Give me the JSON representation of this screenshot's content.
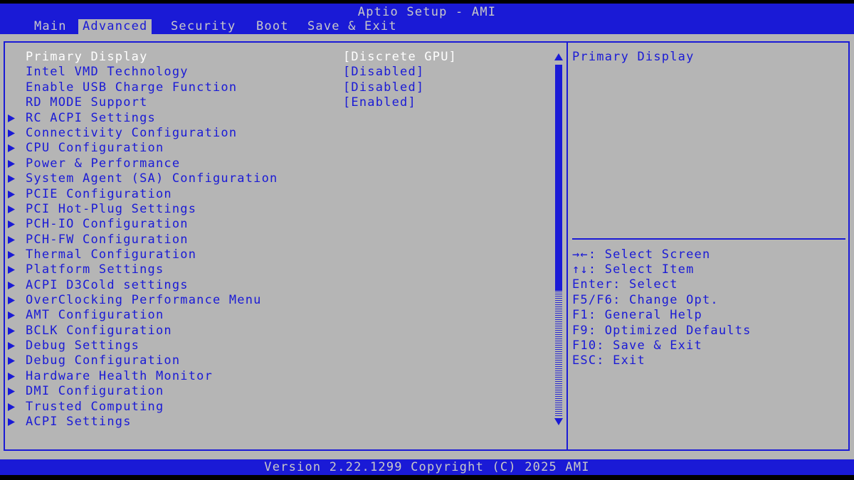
{
  "header": {
    "title": "Aptio Setup - AMI",
    "tabs": [
      {
        "label": "Main"
      },
      {
        "label": "Advanced",
        "active": true
      },
      {
        "label": "Security"
      },
      {
        "label": "Boot"
      },
      {
        "label": "Save & Exit"
      }
    ]
  },
  "settings": [
    {
      "label": "Primary Display",
      "value": "[Discrete GPU]",
      "selected": true
    },
    {
      "label": "Intel VMD Technology",
      "value": "[Disabled]"
    },
    {
      "label": "Enable USB Charge Function",
      "value": "[Disabled]"
    },
    {
      "label": "RD MODE Support",
      "value": "[Enabled]"
    }
  ],
  "submenus": [
    {
      "label": "RC ACPI Settings"
    },
    {
      "label": "Connectivity Configuration"
    },
    {
      "label": "CPU Configuration"
    },
    {
      "label": "Power & Performance"
    },
    {
      "label": "System Agent (SA) Configuration"
    },
    {
      "label": "PCIE Configuration"
    },
    {
      "label": "PCI Hot-Plug Settings"
    },
    {
      "label": "PCH-IO Configuration"
    },
    {
      "label": "PCH-FW Configuration"
    },
    {
      "label": "Thermal Configuration"
    },
    {
      "label": "Platform Settings"
    },
    {
      "label": "ACPI D3Cold settings"
    },
    {
      "label": "OverClocking Performance Menu"
    },
    {
      "label": "AMT Configuration"
    },
    {
      "label": "BCLK Configuration"
    },
    {
      "label": "Debug Settings"
    },
    {
      "label": "Debug Configuration"
    },
    {
      "label": "Hardware Health Monitor"
    },
    {
      "label": "DMI Configuration"
    },
    {
      "label": "Trusted Computing"
    },
    {
      "label": "ACPI Settings"
    }
  ],
  "help": {
    "title": "Primary Display",
    "keys": [
      "→←: Select Screen",
      "↑↓: Select Item",
      "Enter: Select",
      "F5/F6: Change Opt.",
      "F1: General Help",
      "F9: Optimized Defaults",
      "F10: Save & Exit",
      "ESC: Exit"
    ]
  },
  "footer": {
    "version": "Version 2.22.1299 Copyright (C) 2025 AMI"
  },
  "colors": {
    "bios_blue": "#1a1ad6",
    "bios_gray": "#b5b5b5",
    "header_text": "#c8c8c8",
    "selected_text": "#ffffff"
  }
}
